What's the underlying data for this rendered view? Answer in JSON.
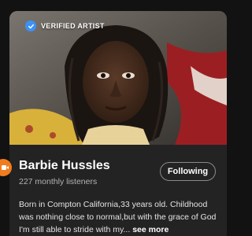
{
  "artist": {
    "verified_label": "VERIFIED ARTIST",
    "name": "Barbie Hussles",
    "monthly_listeners": "227 monthly listeners",
    "follow_label": "Following",
    "bio_text": "Born in Compton California,33 years old. Childhood was nothing close to normal,but with the grace of God I'm still able to stride with my...",
    "see_more_label": "see more"
  },
  "icons": {
    "verified": "verified-check-icon",
    "fab": "video-icon"
  },
  "colors": {
    "background": "#121212",
    "card": "#232323",
    "verified_badge": "#3d91f4",
    "fab": "#f07c1f",
    "secondary_text": "#b3b3b3"
  }
}
